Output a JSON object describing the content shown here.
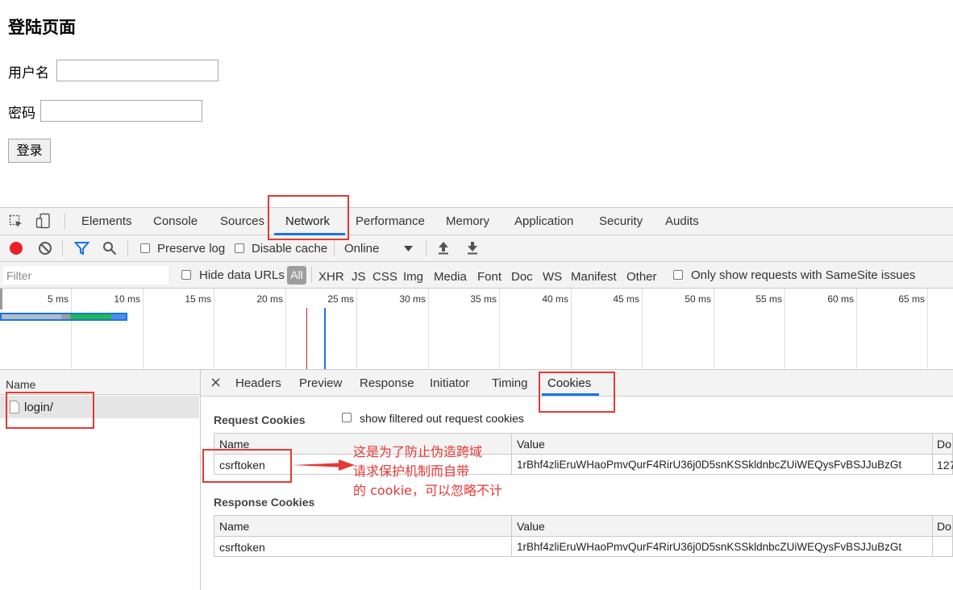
{
  "page": {
    "title": "登陆页面",
    "username_label": "用户名",
    "password_label": "密码",
    "login_button": "登录"
  },
  "devtools": {
    "tabs": [
      "Elements",
      "Console",
      "Sources",
      "Network",
      "Performance",
      "Memory",
      "Application",
      "Security",
      "Audits"
    ],
    "active_tab": "Network",
    "toolbar": {
      "preserve_log": "Preserve log",
      "disable_cache": "Disable cache",
      "throttling": "Online"
    },
    "filter": {
      "placeholder": "Filter",
      "hide_data_urls": "Hide data URLs",
      "types": [
        "All",
        "XHR",
        "JS",
        "CSS",
        "Img",
        "Media",
        "Font",
        "Doc",
        "WS",
        "Manifest",
        "Other"
      ],
      "samesite": "Only show requests with SameSite issues"
    },
    "timeline_ticks": [
      "5 ms",
      "10 ms",
      "15 ms",
      "20 ms",
      "25 ms",
      "30 ms",
      "35 ms",
      "40 ms",
      "45 ms",
      "50 ms",
      "55 ms",
      "60 ms",
      "65 ms"
    ],
    "requests_header": "Name",
    "requests": [
      "login/"
    ],
    "detail_tabs": [
      "Headers",
      "Preview",
      "Response",
      "Initiator",
      "Timing",
      "Cookies"
    ],
    "active_detail_tab": "Cookies",
    "close_symbol": "×",
    "request_cookies": {
      "title": "Request Cookies",
      "show_filtered": "show filtered out request cookies",
      "columns": [
        "Name",
        "Value",
        "Do"
      ],
      "rows": [
        {
          "name": "csrftoken",
          "value": "1rBhf4zliEruWHaoPmvQurF4RirU36j0D5snKSSkldnbcZUiWEQysFvBSJJuBzGt",
          "domain": "127"
        }
      ]
    },
    "response_cookies": {
      "title": "Response Cookies",
      "columns": [
        "Name",
        "Value",
        "Do"
      ],
      "rows": [
        {
          "name": "csrftoken",
          "value": "1rBhf4zliEruWHaoPmvQurF4RirU36j0D5snKSSkldnbcZUiWEQysFvBSJJuBzGt",
          "domain": ""
        }
      ]
    }
  },
  "annotation": {
    "line1": "这是为了防止伪造跨域",
    "line2": "请求保护机制而自带",
    "line3": "的 cookie，可以忽略不计"
  },
  "colors": {
    "accent": "#1a73e8",
    "annotation": "#e53935",
    "record": "#e8202a"
  }
}
